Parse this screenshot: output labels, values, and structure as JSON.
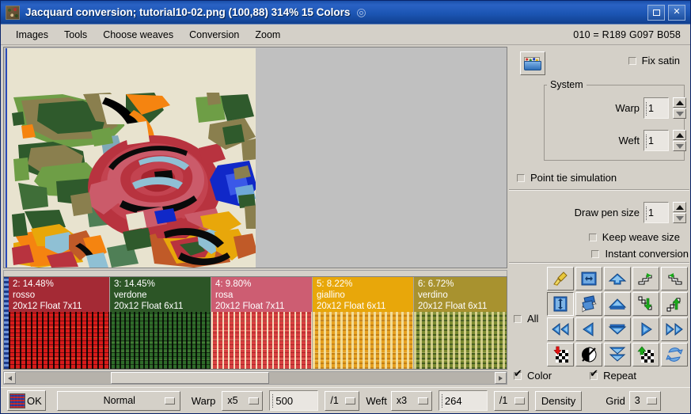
{
  "window": {
    "title": "Jacquard conversion; tutorial10-02.png (100,88) 314% 15 Colors",
    "title_glyph": "◎",
    "icon_name": "fabric-thumbnail-icon",
    "maximize_label": "□",
    "close_label": "✕"
  },
  "menubar": {
    "items": [
      {
        "label": "Images"
      },
      {
        "label": "Tools"
      },
      {
        "label": "Choose weaves"
      },
      {
        "label": "Conversion"
      },
      {
        "label": "Zoom"
      }
    ],
    "rgb_readout": "010 = R189 G097 B058"
  },
  "swatches": [
    {
      "index": "2",
      "header_line1": "2: 14.48%",
      "header_line2": "rosso",
      "header_line3": "20x12 Float 7x11",
      "name": "rosso",
      "percent": "14.48%",
      "weave": "20x12 Float 7x11",
      "color": "#a42a35",
      "weave_color": "#d81a1a"
    },
    {
      "index": "3",
      "header_line1": "3: 14.45%",
      "header_line2": "verdone",
      "header_line3": "20x12 Float 6x11",
      "name": "verdone",
      "percent": "14.45%",
      "weave": "20x12 Float 6x11",
      "color": "#2c5526",
      "weave_color": "#2f6b2a"
    },
    {
      "index": "4",
      "header_line1": "4: 9.80%",
      "header_line2": "rosa",
      "header_line3": "20x12 Float 7x11",
      "name": "rosa",
      "percent": "9.80%",
      "weave": "20x12 Float 7x11",
      "color": "#cd5d72",
      "weave_color": "#d84040"
    },
    {
      "index": "5",
      "header_line1": "5: 8.22%",
      "header_line2": "giallino",
      "header_line3": "20x12 Float 6x11",
      "name": "giallino",
      "percent": "8.22%",
      "weave": "20x12 Float 6x11",
      "color": "#e8a70a",
      "weave_color": "#e6a020"
    },
    {
      "index": "6",
      "header_line1": "6: 6.72%",
      "header_line2": "verdino",
      "header_line3": "20x12 Float 6x11",
      "name": "verdino",
      "percent": "6.72%",
      "weave": "20x12 Float 6x11",
      "color": "#a8922f",
      "weave_color": "#7a8a30"
    }
  ],
  "right_panel": {
    "fix_satin": {
      "label": "Fix satin",
      "checked": false
    },
    "system": {
      "legend": "System",
      "warp_label": "Warp",
      "warp_value": "1",
      "weft_label": "Weft",
      "weft_value": "1"
    },
    "point_tie": {
      "label": "Point tie simulation",
      "checked": false
    },
    "pen": {
      "label": "Draw pen size",
      "value": "1"
    },
    "keep_weave": {
      "label": "Keep weave size",
      "checked": false
    },
    "instant": {
      "label": "Instant conversion",
      "checked": false
    },
    "all": {
      "label": "All",
      "checked": false
    },
    "color": {
      "label": "Color",
      "checked": true
    },
    "repeat": {
      "label": "Repeat",
      "checked": true
    },
    "icon_buttons": [
      "broom-icon",
      "flip-horizontal-icon",
      "arrow-up-fill-icon",
      "stairs-right-down-icon",
      "stairs-left-down-icon",
      "resize-vertical-icon",
      "shuffle-layers-icon",
      "arrow-up-outline-icon",
      "stairs-arrow-down-icon",
      "stairs-arrow-up-icon",
      "rewind-left-icon",
      "arrow-left-icon",
      "arrow-down-outline-icon",
      "arrow-right-icon",
      "fast-forward-right-icon",
      "checker-arrow-down-icon",
      "invert-circle-icon",
      "arrow-down-double-icon",
      "checker-arrow-up-icon",
      "refresh-cycle-icon"
    ]
  },
  "bottombar": {
    "ok_label": "OK",
    "ok_swatch_name": "weave-preview-swatch",
    "mode": "Normal",
    "warp_label": "Warp",
    "warp_mult": "x5",
    "warp_value": "500",
    "warp_div": "/1",
    "weft_label": "Weft",
    "weft_mult": "x3",
    "weft_value": "264",
    "weft_div": "/1",
    "density_label": "Density",
    "grid_label": "Grid",
    "grid_value": "3"
  },
  "colors": {
    "titlebar_blue": "#1c56b4",
    "panel_gray": "#d4d0c8",
    "accent_blue": "#2a4bb8",
    "canvas_bg": "#e8e3cf"
  }
}
